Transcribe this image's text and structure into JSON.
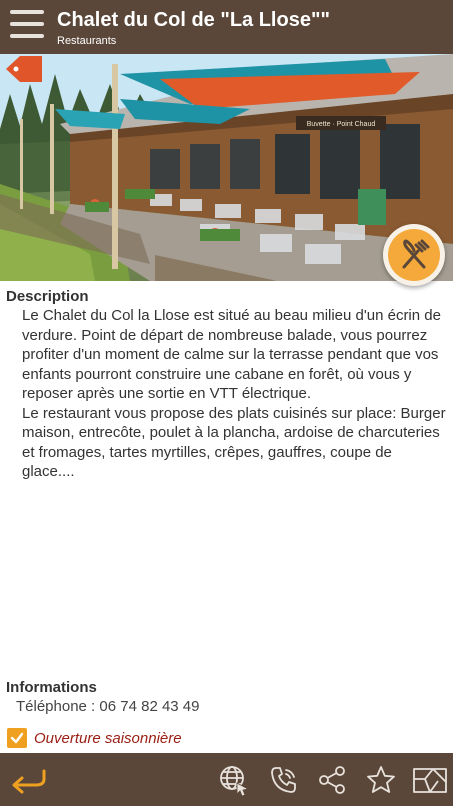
{
  "header": {
    "title": "Chalet du Col de \"La Llose\"\"",
    "subtitle": "Restaurants",
    "menu_icon": "hamburger-menu-icon"
  },
  "photo": {
    "alt": "Terrasse du chalet",
    "category_icon": "fork-knife-icon",
    "tag_icon": "price-tag-icon",
    "slide_count": 2,
    "active_slide": 1,
    "sign_text": "Buvette · Point Chaud"
  },
  "description": {
    "title": "Description",
    "paragraph1": "Le Chalet du Col la Llose est situé au beau milieu d'un écrin de verdure. Point de départ de nombreuse balade, vous pourrez profiter d'un moment de calme sur la terrasse pendant que vos enfants pourront construire une cabane en forêt, où vous y reposer après une sortie en VTT électrique.",
    "paragraph2": "Le restaurant vous propose des plats cuisinés sur place: Burger maison, entrecôte, poulet à la plancha, ardoise de charcuteries et fromages, tartes myrtilles, crêpes, gauffres, coupe de glace...."
  },
  "informations": {
    "title": "Informations",
    "phone_line": "Téléphone : 06 74 82 43 49",
    "seasonal_label": "Ouverture saisonnière",
    "seasonal_checked": true
  },
  "footer": {
    "icons": [
      "back-arrow-icon",
      "website-globe-icon",
      "phone-call-icon",
      "share-icon",
      "favorite-star-icon",
      "map-icon"
    ]
  },
  "colors": {
    "bar": "#5a4739",
    "accent": "#f0a020",
    "seasonal_text": "#9a1d14"
  }
}
